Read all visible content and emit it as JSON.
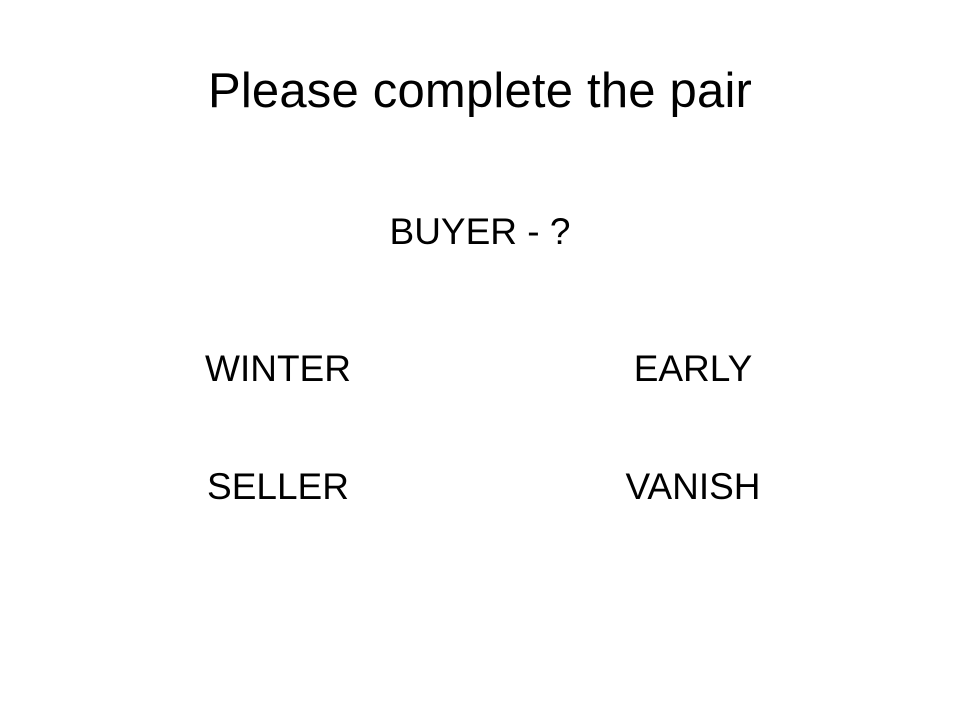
{
  "slide": {
    "title": "Please complete the pair",
    "prompt": "BUYER - ?",
    "options": [
      "WINTER",
      "EARLY",
      "SELLER",
      "VANISH"
    ]
  }
}
